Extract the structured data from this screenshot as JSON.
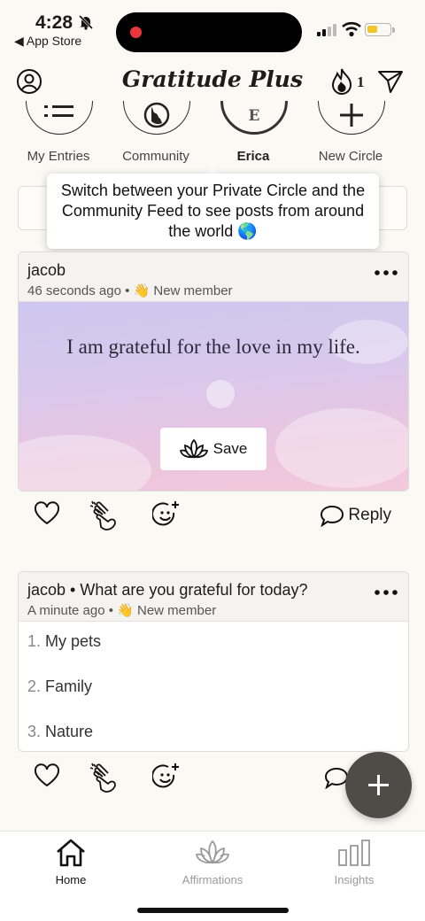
{
  "status_bar": {
    "time": "4:28",
    "back_label": "◀ App Store"
  },
  "header": {
    "title": "Gratitude Plus",
    "streak_count": "1"
  },
  "circles": [
    {
      "label": "My Entries",
      "icon": "list-icon"
    },
    {
      "label": "Community",
      "icon": "globe-icon"
    },
    {
      "label": "Erica",
      "letter": "E",
      "active": true
    },
    {
      "label": "New Circle",
      "icon": "plus-icon"
    }
  ],
  "tooltip": {
    "text": "Switch between your Private Circle and the Community Feed to see posts from around the world 🌎"
  },
  "post1": {
    "author": "jacob",
    "time": "46 seconds ago",
    "badge": "👋 New member",
    "affirmation": "I am grateful for the love in my life.",
    "save_label": "Save",
    "reply_label": "Reply"
  },
  "post2": {
    "author": "jacob",
    "prompt": "What are you grateful for today?",
    "time": "A minute ago",
    "badge": "👋 New member",
    "items": [
      "My pets",
      "Family",
      "Nature"
    ]
  },
  "tabs": [
    {
      "label": "Home",
      "active": true
    },
    {
      "label": "Affirmations"
    },
    {
      "label": "Insights"
    }
  ],
  "colors": {
    "background": "#fbf9f4",
    "fab": "#4f4c48",
    "recording_dot": "#e8363c",
    "battery": "#f4c528"
  }
}
